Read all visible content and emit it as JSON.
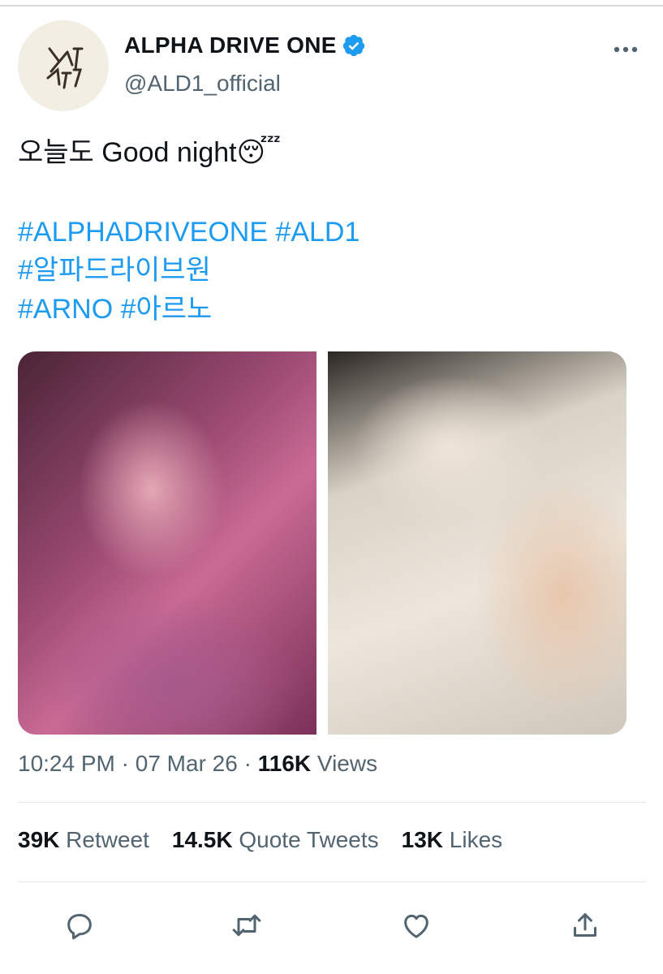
{
  "header": {
    "display_name": "ALPHA DRIVE ONE",
    "handle": "@ALD1_official",
    "avatar_logo_text": "ALD1"
  },
  "tweet": {
    "text": "오늘도 Good night",
    "emoji": "😴",
    "hashtags": [
      "#ALPHADRIVEONE #ALD1",
      "#알파드라이브원",
      "#ARNO #아르노"
    ],
    "photos": [
      "photo-1",
      "photo-2"
    ],
    "time": "10:24 PM",
    "date": "07 Mar 26",
    "views_count": "116K",
    "views_label": "Views"
  },
  "stats": [
    {
      "count": "39K",
      "label": "Retweet"
    },
    {
      "count": "14.5K",
      "label": "Quote Tweets"
    },
    {
      "count": "13K",
      "label": "Likes"
    }
  ],
  "actions": [
    "reply-icon",
    "retweet-icon",
    "like-icon",
    "share-icon"
  ],
  "colors": {
    "accent": "#1d9bf0",
    "secondary_text": "#536471",
    "verified": "#1d9bf0"
  }
}
